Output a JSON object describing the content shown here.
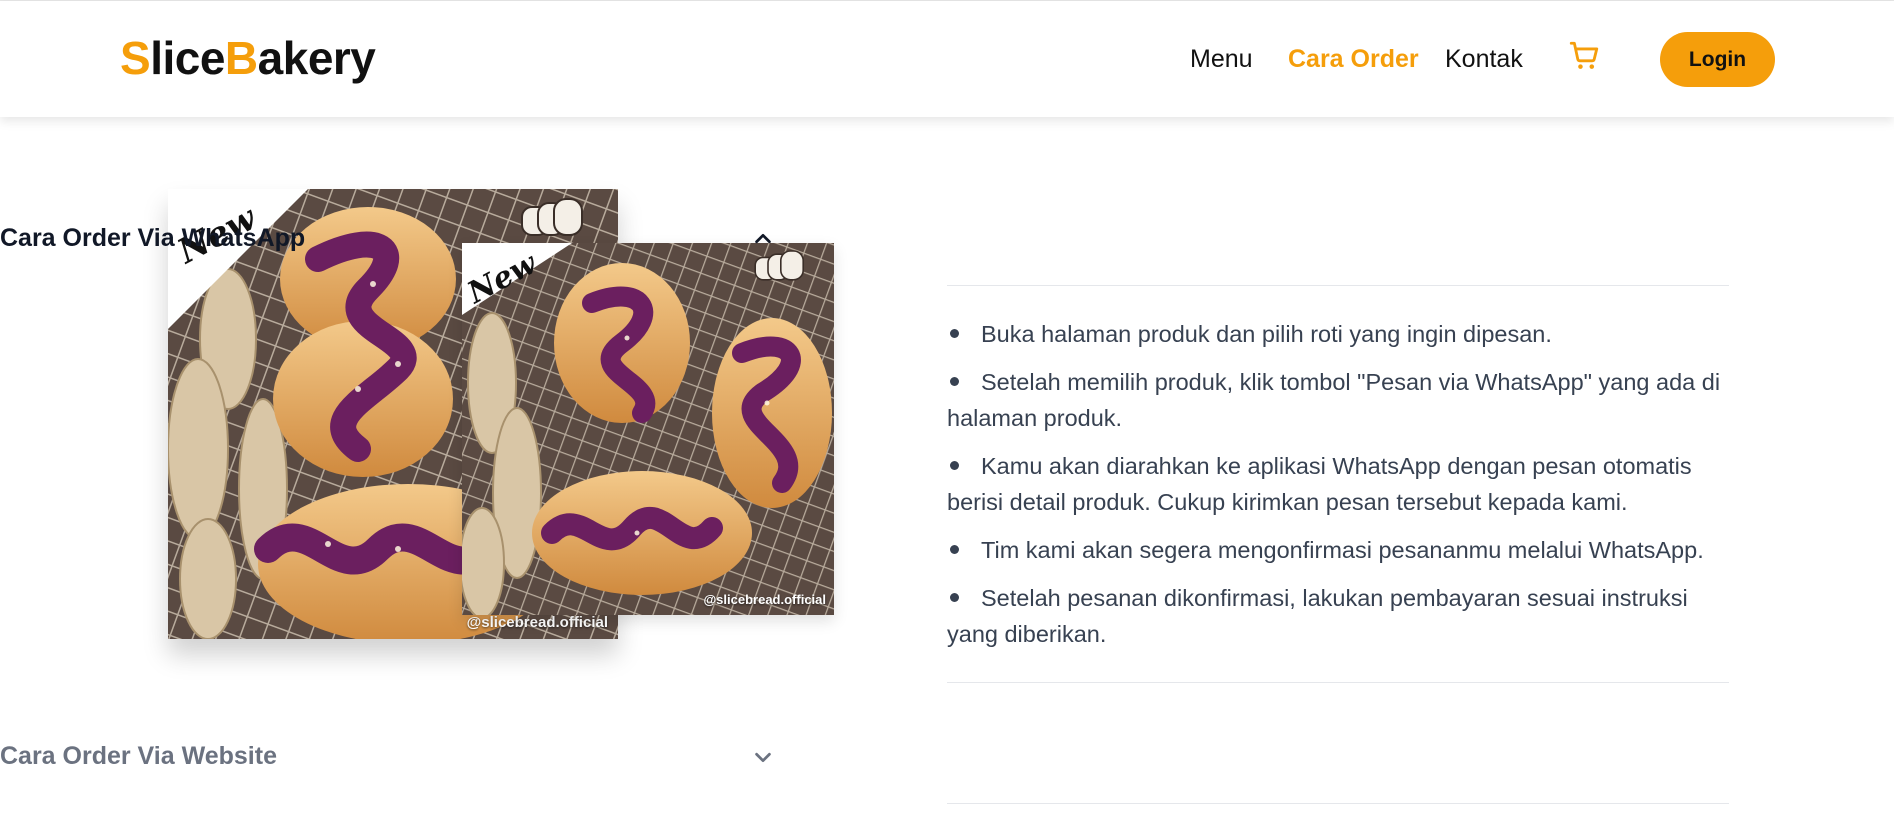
{
  "header": {
    "logo": {
      "first_letter": "S",
      "part1": "lice",
      "second_letter": "B",
      "part2": "akery"
    },
    "nav": {
      "menu": "Menu",
      "cara_order": "Cara Order",
      "kontak": "Kontak"
    },
    "cart_icon": "shopping-cart-icon",
    "login_label": "Login",
    "colors": {
      "accent": "#f59e0b"
    }
  },
  "gallery": {
    "back_photo": {
      "badge": "New",
      "handle": "@slicebread.official"
    },
    "front_photo": {
      "badge": "New",
      "handle": "@slicebread.official"
    }
  },
  "accordion": {
    "sections": [
      {
        "title": "Cara Order Via WhatsApp",
        "expanded": true,
        "icon": "chevron-up-icon",
        "steps": [
          "Buka halaman produk dan pilih roti yang ingin dipesan.",
          "Setelah memilih produk, klik tombol \"Pesan via WhatsApp\" yang ada di halaman produk.",
          "Kamu akan diarahkan ke aplikasi WhatsApp dengan pesan otomatis berisi detail produk. Cukup kirimkan pesan tersebut kepada kami.",
          "Tim kami akan segera mengonfirmasi pesananmu melalui WhatsApp.",
          "Setelah pesanan dikonfirmasi, lakukan pembayaran sesuai instruksi yang diberikan."
        ]
      },
      {
        "title": "Cara Order Via Website",
        "expanded": false,
        "icon": "chevron-down-icon"
      }
    ]
  }
}
